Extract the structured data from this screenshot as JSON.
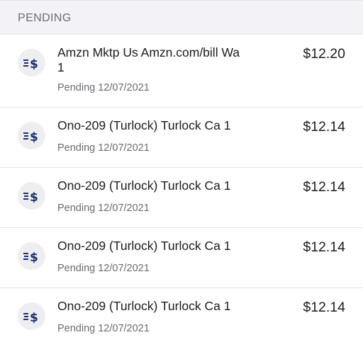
{
  "section": {
    "title": "PENDING"
  },
  "transactions": [
    {
      "icon": "pending-payment-icon",
      "description": "Amzn Mktp Us Amzn.com/bill Wa 1",
      "status": "Pending 12/07/2021",
      "amount": "$12.20"
    },
    {
      "icon": "pending-payment-icon",
      "description": "Ono-209 (Turlock) Turlock Ca 1",
      "status": "Pending 12/07/2021",
      "amount": "$12.14"
    },
    {
      "icon": "pending-payment-icon",
      "description": "Ono-209 (Turlock) Turlock Ca 1",
      "status": "Pending 12/07/2021",
      "amount": "$12.14"
    },
    {
      "icon": "pending-payment-icon",
      "description": "Ono-209 (Turlock) Turlock Ca 1",
      "status": "Pending 12/07/2021",
      "amount": "$12.14"
    },
    {
      "icon": "pending-payment-icon",
      "description": "Ono-209 (Turlock) Turlock Ca 1",
      "status": "Pending 12/07/2021",
      "amount": "$12.14"
    }
  ],
  "colors": {
    "icon": "#1f2f6e",
    "header_bg": "#f2f2f7"
  }
}
